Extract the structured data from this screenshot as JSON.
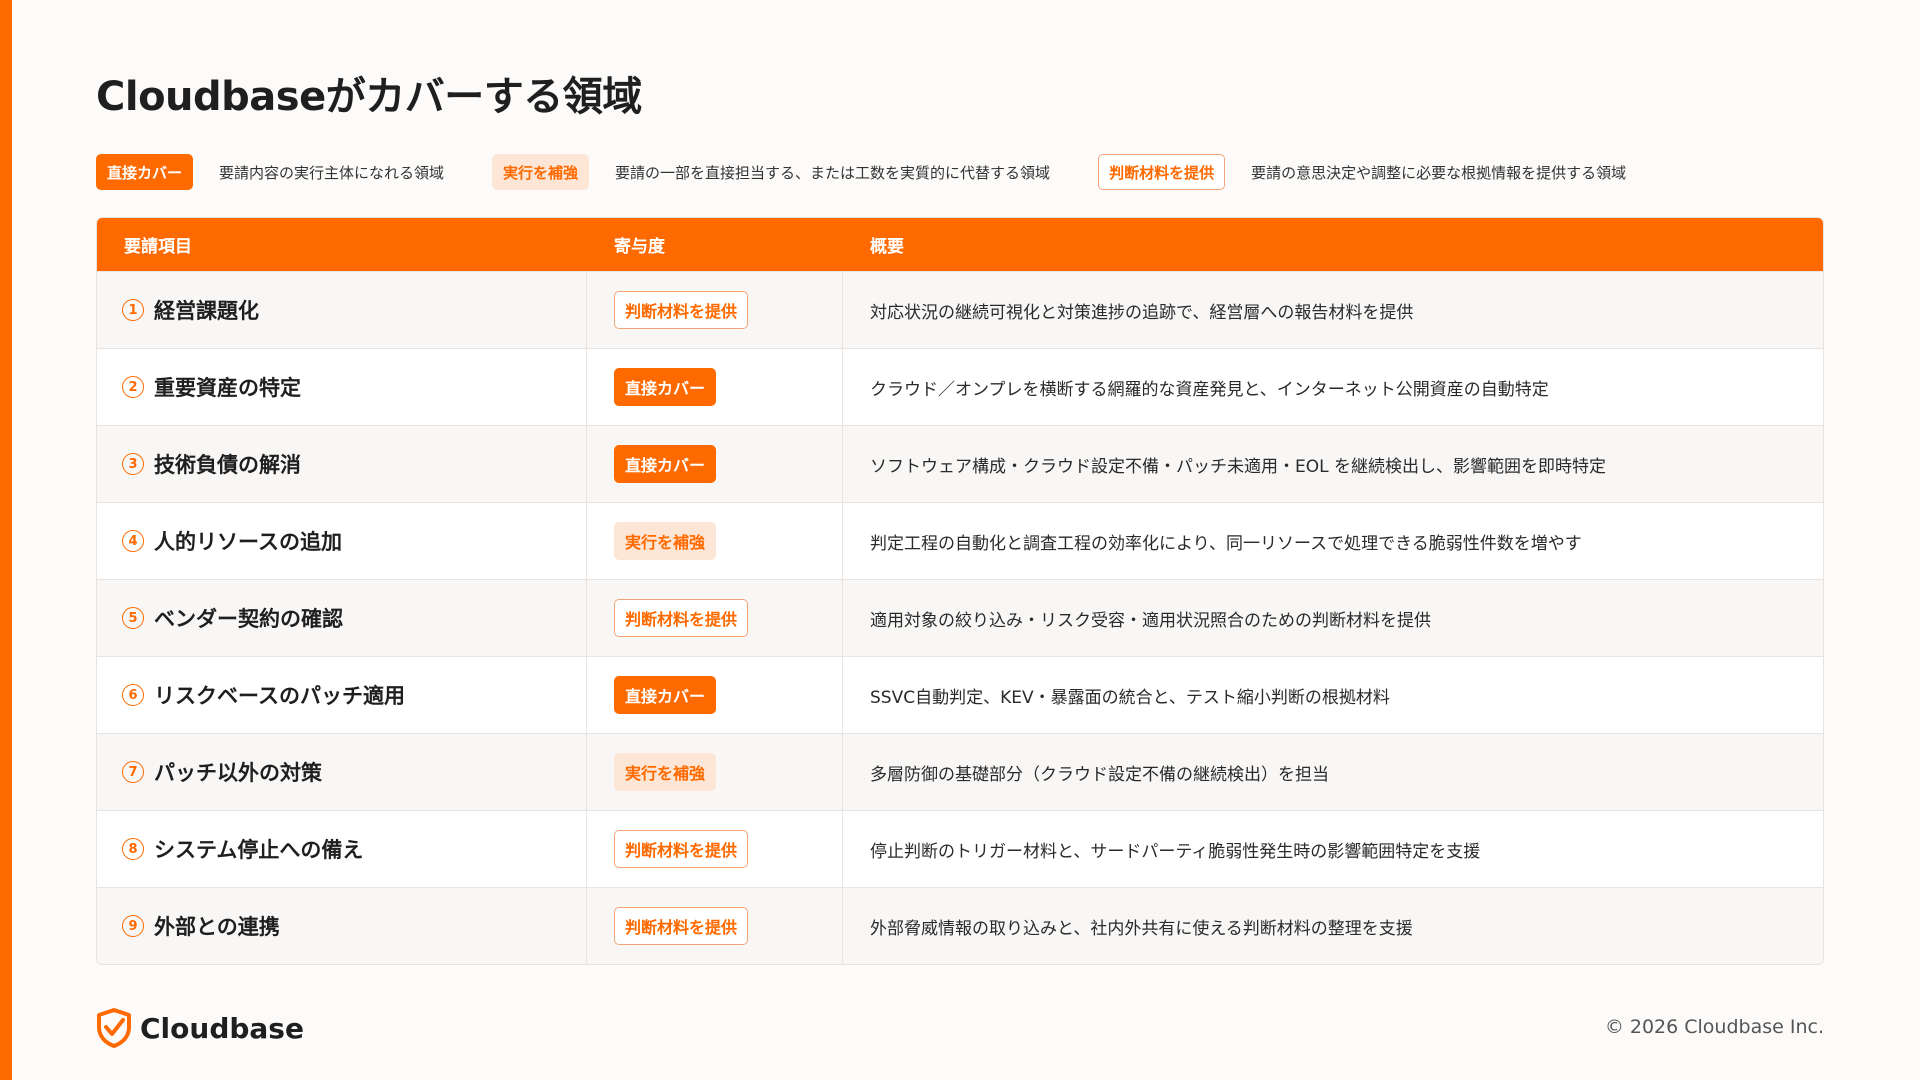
{
  "title": "Cloudbaseがカバーする領域",
  "legend": [
    {
      "type": "direct",
      "label": "直接カバー",
      "description": "要請内容の実行主体になれる領域"
    },
    {
      "type": "support",
      "label": "実行を補強",
      "description": "要請の一部を直接担当する、または工数を実質的に代替する領域"
    },
    {
      "type": "info",
      "label": "判断材料を提供",
      "description": "要請の意思決定や調整に必要な根拠情報を提供する領域"
    }
  ],
  "table": {
    "headers": [
      "要請項目",
      "寄与度",
      "概要"
    ],
    "rows": [
      {
        "num": "1",
        "item": "経営課題化",
        "type": "info",
        "badge": "判断材料を提供",
        "summary": "対応状況の継続可視化と対策進捗の追跡で、経営層への報告材料を提供"
      },
      {
        "num": "2",
        "item": "重要資産の特定",
        "type": "direct",
        "badge": "直接カバー",
        "summary": "クラウド／オンプレを横断する網羅的な資産発見と、インターネット公開資産の自動特定"
      },
      {
        "num": "3",
        "item": "技術負債の解消",
        "type": "direct",
        "badge": "直接カバー",
        "summary": "ソフトウェア構成・クラウド設定不備・パッチ未適用・EOL を継続検出し、影響範囲を即時特定"
      },
      {
        "num": "4",
        "item": "人的リソースの追加",
        "type": "support",
        "badge": "実行を補強",
        "summary": "判定工程の自動化と調査工程の効率化により、同一リソースで処理できる脆弱性件数を増やす"
      },
      {
        "num": "5",
        "item": "ベンダー契約の確認",
        "type": "info",
        "badge": "判断材料を提供",
        "summary": "適用対象の絞り込み・リスク受容・適用状況照合のための判断材料を提供"
      },
      {
        "num": "6",
        "item": "リスクベースのパッチ適用",
        "type": "direct",
        "badge": "直接カバー",
        "summary": "SSVC自動判定、KEV・暴露面の統合と、テスト縮小判断の根拠材料"
      },
      {
        "num": "7",
        "item": "パッチ以外の対策",
        "type": "support",
        "badge": "実行を補強",
        "summary": "多層防御の基礎部分（クラウド設定不備の継続検出）を担当"
      },
      {
        "num": "8",
        "item": "システム停止への備え",
        "type": "info",
        "badge": "判断材料を提供",
        "summary": "停止判断のトリガー材料と、サードパーティ脆弱性発生時の影響範囲特定を支援"
      },
      {
        "num": "9",
        "item": "外部との連携",
        "type": "info",
        "badge": "判断材料を提供",
        "summary": "外部脅威情報の取り込みと、社内外共有に使える判断材料の整理を支援"
      }
    ]
  },
  "footer": {
    "logo_text": "Cloudbase",
    "copyright": "© 2026 Cloudbase Inc."
  },
  "colors": {
    "accent": "#ff6a00",
    "support_bg": "#fde6d6"
  },
  "icons": {
    "logo": "shield-check-icon"
  }
}
